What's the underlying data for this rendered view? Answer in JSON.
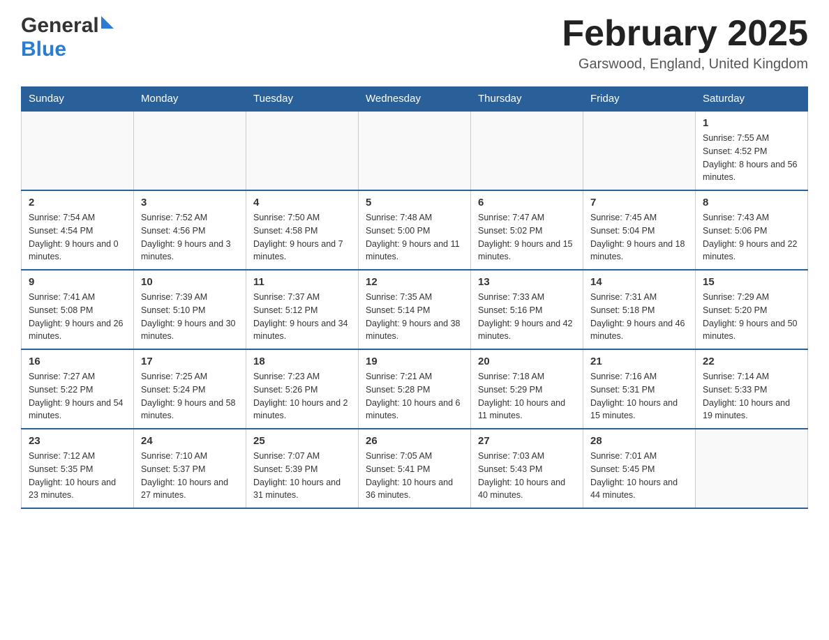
{
  "header": {
    "logo_general": "General",
    "logo_blue": "Blue",
    "title": "February 2025",
    "location": "Garswood, England, United Kingdom"
  },
  "days_of_week": [
    "Sunday",
    "Monday",
    "Tuesday",
    "Wednesday",
    "Thursday",
    "Friday",
    "Saturday"
  ],
  "weeks": [
    {
      "days": [
        {
          "num": "",
          "info": ""
        },
        {
          "num": "",
          "info": ""
        },
        {
          "num": "",
          "info": ""
        },
        {
          "num": "",
          "info": ""
        },
        {
          "num": "",
          "info": ""
        },
        {
          "num": "",
          "info": ""
        },
        {
          "num": "1",
          "info": "Sunrise: 7:55 AM\nSunset: 4:52 PM\nDaylight: 8 hours and 56 minutes."
        }
      ]
    },
    {
      "days": [
        {
          "num": "2",
          "info": "Sunrise: 7:54 AM\nSunset: 4:54 PM\nDaylight: 9 hours and 0 minutes."
        },
        {
          "num": "3",
          "info": "Sunrise: 7:52 AM\nSunset: 4:56 PM\nDaylight: 9 hours and 3 minutes."
        },
        {
          "num": "4",
          "info": "Sunrise: 7:50 AM\nSunset: 4:58 PM\nDaylight: 9 hours and 7 minutes."
        },
        {
          "num": "5",
          "info": "Sunrise: 7:48 AM\nSunset: 5:00 PM\nDaylight: 9 hours and 11 minutes."
        },
        {
          "num": "6",
          "info": "Sunrise: 7:47 AM\nSunset: 5:02 PM\nDaylight: 9 hours and 15 minutes."
        },
        {
          "num": "7",
          "info": "Sunrise: 7:45 AM\nSunset: 5:04 PM\nDaylight: 9 hours and 18 minutes."
        },
        {
          "num": "8",
          "info": "Sunrise: 7:43 AM\nSunset: 5:06 PM\nDaylight: 9 hours and 22 minutes."
        }
      ]
    },
    {
      "days": [
        {
          "num": "9",
          "info": "Sunrise: 7:41 AM\nSunset: 5:08 PM\nDaylight: 9 hours and 26 minutes."
        },
        {
          "num": "10",
          "info": "Sunrise: 7:39 AM\nSunset: 5:10 PM\nDaylight: 9 hours and 30 minutes."
        },
        {
          "num": "11",
          "info": "Sunrise: 7:37 AM\nSunset: 5:12 PM\nDaylight: 9 hours and 34 minutes."
        },
        {
          "num": "12",
          "info": "Sunrise: 7:35 AM\nSunset: 5:14 PM\nDaylight: 9 hours and 38 minutes."
        },
        {
          "num": "13",
          "info": "Sunrise: 7:33 AM\nSunset: 5:16 PM\nDaylight: 9 hours and 42 minutes."
        },
        {
          "num": "14",
          "info": "Sunrise: 7:31 AM\nSunset: 5:18 PM\nDaylight: 9 hours and 46 minutes."
        },
        {
          "num": "15",
          "info": "Sunrise: 7:29 AM\nSunset: 5:20 PM\nDaylight: 9 hours and 50 minutes."
        }
      ]
    },
    {
      "days": [
        {
          "num": "16",
          "info": "Sunrise: 7:27 AM\nSunset: 5:22 PM\nDaylight: 9 hours and 54 minutes."
        },
        {
          "num": "17",
          "info": "Sunrise: 7:25 AM\nSunset: 5:24 PM\nDaylight: 9 hours and 58 minutes."
        },
        {
          "num": "18",
          "info": "Sunrise: 7:23 AM\nSunset: 5:26 PM\nDaylight: 10 hours and 2 minutes."
        },
        {
          "num": "19",
          "info": "Sunrise: 7:21 AM\nSunset: 5:28 PM\nDaylight: 10 hours and 6 minutes."
        },
        {
          "num": "20",
          "info": "Sunrise: 7:18 AM\nSunset: 5:29 PM\nDaylight: 10 hours and 11 minutes."
        },
        {
          "num": "21",
          "info": "Sunrise: 7:16 AM\nSunset: 5:31 PM\nDaylight: 10 hours and 15 minutes."
        },
        {
          "num": "22",
          "info": "Sunrise: 7:14 AM\nSunset: 5:33 PM\nDaylight: 10 hours and 19 minutes."
        }
      ]
    },
    {
      "days": [
        {
          "num": "23",
          "info": "Sunrise: 7:12 AM\nSunset: 5:35 PM\nDaylight: 10 hours and 23 minutes."
        },
        {
          "num": "24",
          "info": "Sunrise: 7:10 AM\nSunset: 5:37 PM\nDaylight: 10 hours and 27 minutes."
        },
        {
          "num": "25",
          "info": "Sunrise: 7:07 AM\nSunset: 5:39 PM\nDaylight: 10 hours and 31 minutes."
        },
        {
          "num": "26",
          "info": "Sunrise: 7:05 AM\nSunset: 5:41 PM\nDaylight: 10 hours and 36 minutes."
        },
        {
          "num": "27",
          "info": "Sunrise: 7:03 AM\nSunset: 5:43 PM\nDaylight: 10 hours and 40 minutes."
        },
        {
          "num": "28",
          "info": "Sunrise: 7:01 AM\nSunset: 5:45 PM\nDaylight: 10 hours and 44 minutes."
        },
        {
          "num": "",
          "info": ""
        }
      ]
    }
  ]
}
